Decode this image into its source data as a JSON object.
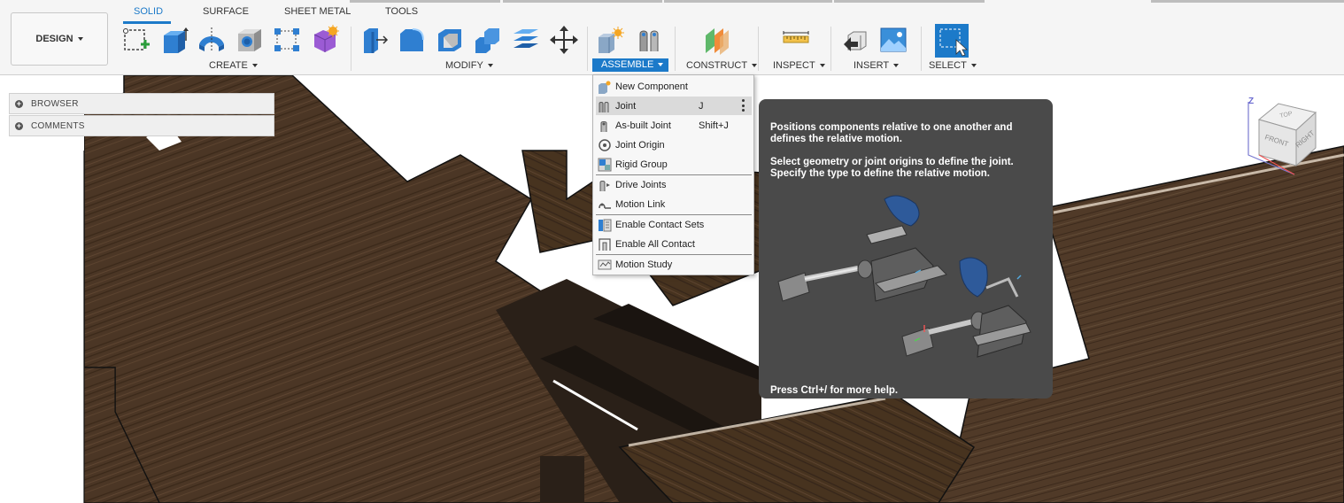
{
  "workspace": {
    "label": "DESIGN"
  },
  "tabs": [
    {
      "label": "SOLID",
      "active": true
    },
    {
      "label": "SURFACE",
      "active": false
    },
    {
      "label": "SHEET METAL",
      "active": false
    },
    {
      "label": "TOOLS",
      "active": false
    }
  ],
  "groups": {
    "create": "CREATE",
    "modify": "MODIFY",
    "assemble": "ASSEMBLE",
    "construct": "CONSTRUCT",
    "inspect": "INSPECT",
    "insert": "INSERT",
    "select": "SELECT"
  },
  "browser": {
    "rows": [
      "BROWSER",
      "COMMENTS"
    ]
  },
  "assemble_menu": {
    "items": [
      {
        "label": "New Component",
        "shortcut": "",
        "icon": "new-component-icon"
      },
      {
        "label": "Joint",
        "shortcut": "J",
        "icon": "joint-icon",
        "highlighted": true
      },
      {
        "label": "As-built Joint",
        "shortcut": "Shift+J",
        "icon": "as-built-joint-icon"
      },
      {
        "label": "Joint Origin",
        "shortcut": "",
        "icon": "joint-origin-icon"
      },
      {
        "label": "Rigid Group",
        "shortcut": "",
        "icon": "rigid-group-icon"
      },
      {
        "label": "Drive Joints",
        "shortcut": "",
        "icon": "drive-joints-icon"
      },
      {
        "label": "Motion Link",
        "shortcut": "",
        "icon": "motion-link-icon"
      },
      {
        "label": "Enable Contact Sets",
        "shortcut": "",
        "icon": "enable-contact-sets-icon"
      },
      {
        "label": "Enable All Contact",
        "shortcut": "",
        "icon": "enable-all-contact-icon"
      },
      {
        "label": "Motion Study",
        "shortcut": "",
        "icon": "motion-study-icon"
      }
    ]
  },
  "tooltip": {
    "line1": "Positions components relative to one another and",
    "line2": "defines the relative motion.",
    "line3": "Select geometry or joint origins to define the joint.",
    "line4": "Specify the type to define the relative motion.",
    "footer": "Press Ctrl+/ for more help."
  },
  "viewcube": {
    "top": "TOP",
    "front": "FRONT",
    "right": "RIGHT",
    "axis_z": "Z"
  },
  "colors": {
    "accent": "#1c7ac9",
    "tooltip_bg": "#4a4a4a",
    "wood": "#4a3524"
  }
}
